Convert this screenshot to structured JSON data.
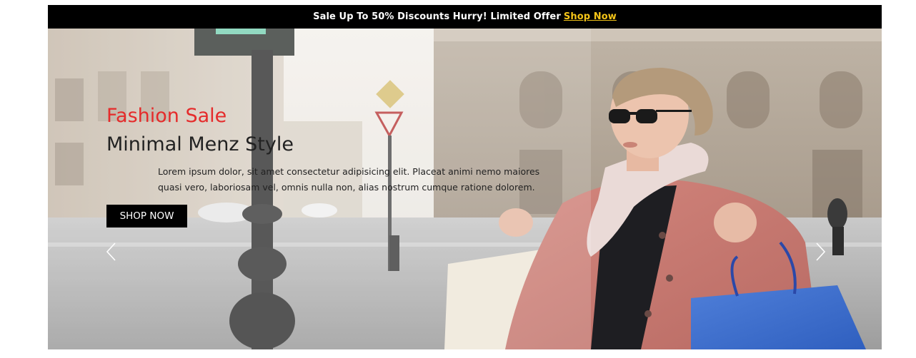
{
  "promo": {
    "message": "Sale Up To 50% Discounts Hurry! Limited Offer",
    "link_label": "Shop Now",
    "link_color": "#f5c518"
  },
  "hero": {
    "kicker": "Fashion Sale",
    "kicker_color": "#e52b2b",
    "headline": "Minimal Menz Style",
    "description": "Lorem ipsum dolor, sit amet consectetur adipisicing elit. Placeat animi nemo maiores quasi vero, laboriosam vel, omnis nulla non, alias nostrum cumque ratione dolorem.",
    "cta_label": "SHOP NOW",
    "prev_icon": "chevron-left-icon",
    "next_icon": "chevron-right-icon",
    "image_subject": "woman in pink coat with shopping bags on street"
  }
}
